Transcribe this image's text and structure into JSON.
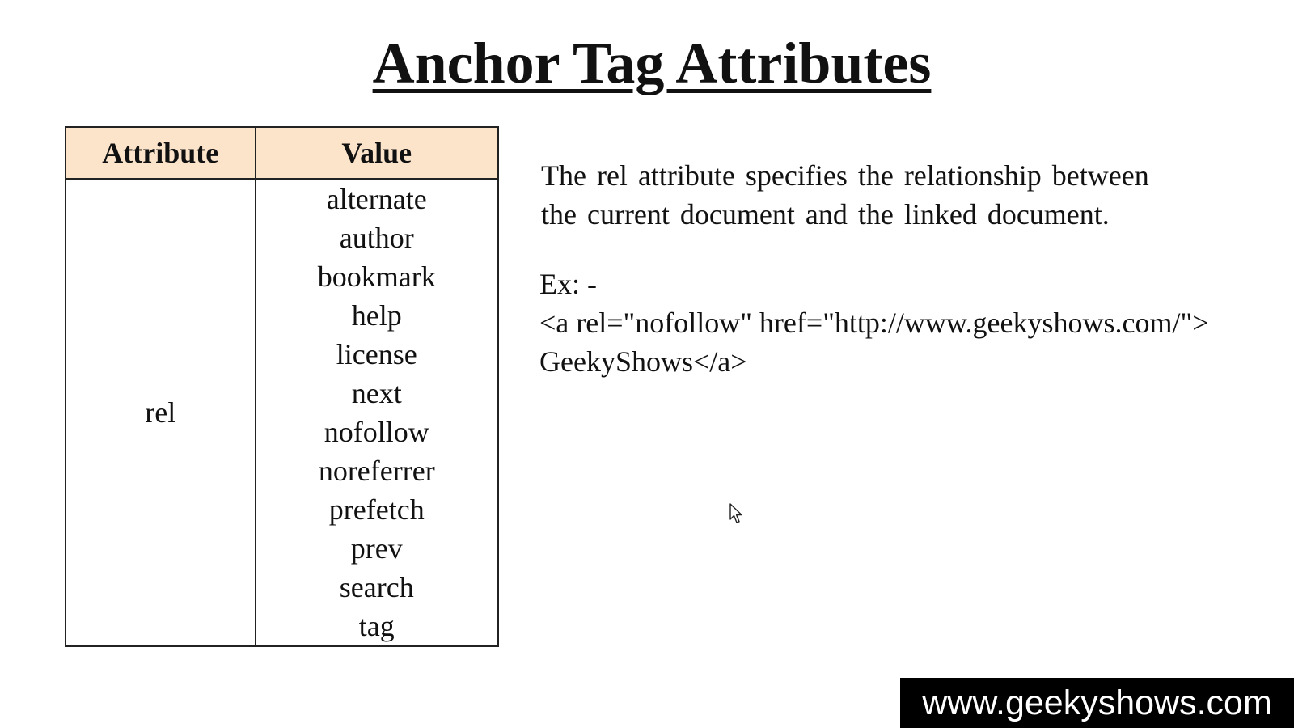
{
  "page": {
    "title": "Anchor Tag Attributes"
  },
  "table": {
    "headers": [
      "Attribute",
      "Value"
    ],
    "attribute": "rel",
    "values": [
      "alternate",
      "author",
      "bookmark",
      "help",
      "license",
      "next",
      "nofollow",
      "noreferrer",
      "prefetch",
      "prev",
      "search",
      "tag"
    ],
    "header_color": "#fce4cb"
  },
  "description": {
    "lines": [
      "The rel attribute specifies the relationship between",
      "the current document and the linked document."
    ]
  },
  "example": {
    "label": "Ex: -",
    "lines": [
      "<a rel=\"nofollow\"  href=\"http://www.geekyshows.com/\">",
      "GeekyShows</a>"
    ]
  },
  "watermark": {
    "text": "www.geekyshows.com"
  },
  "icons": {
    "cursor": "mouse-pointer-icon"
  }
}
